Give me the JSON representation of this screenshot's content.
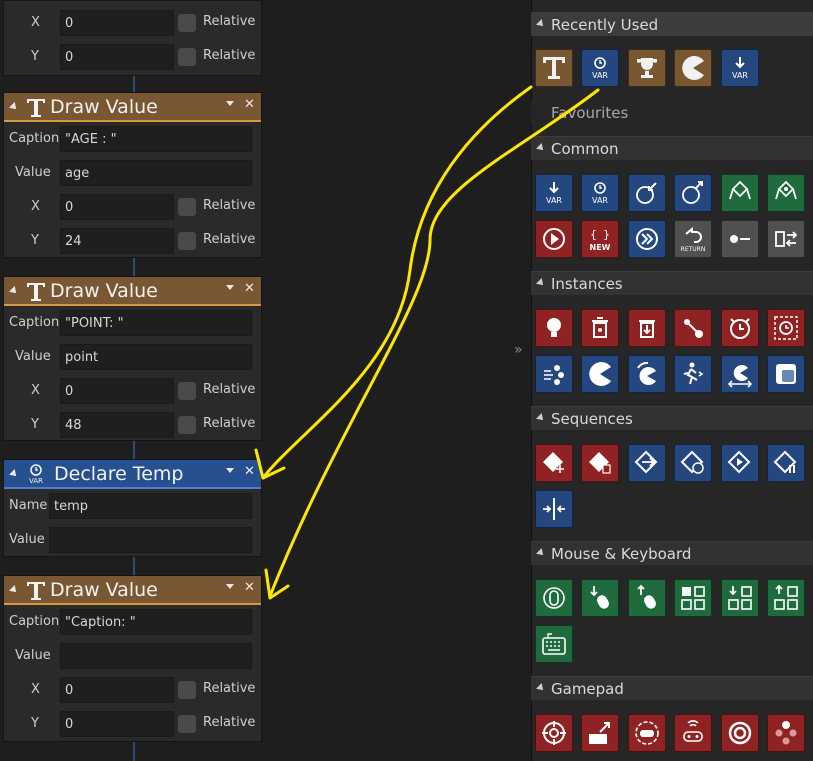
{
  "blocks": {
    "top_partial": {
      "x_label": "X",
      "x_value": "0",
      "x_rel": "Relative",
      "y_label": "Y",
      "y_value": "0",
      "y_rel": "Relative"
    },
    "draw_value_1": {
      "title": "Draw Value",
      "caption_label": "Caption",
      "caption_value": "\"AGE : \"",
      "value_label": "Value",
      "value_value": "age",
      "x_label": "X",
      "x_value": "0",
      "x_rel": "Relative",
      "y_label": "Y",
      "y_value": "24",
      "y_rel": "Relative"
    },
    "draw_value_2": {
      "title": "Draw Value",
      "caption_label": "Caption",
      "caption_value": "\"POINT: \"",
      "value_label": "Value",
      "value_value": "point",
      "x_label": "X",
      "x_value": "0",
      "x_rel": "Relative",
      "y_label": "Y",
      "y_value": "48",
      "y_rel": "Relative"
    },
    "declare_temp": {
      "title": "Declare Temp",
      "icon_text": "VAR",
      "name_label": "Name",
      "name_value": "temp",
      "value_label": "Value",
      "value_value": ""
    },
    "draw_value_3": {
      "title": "Draw Value",
      "caption_label": "Caption",
      "caption_value": "\"Caption: \"",
      "value_label": "Value",
      "value_value": "",
      "x_label": "X",
      "x_value": "0",
      "x_rel": "Relative",
      "y_label": "Y",
      "y_value": "0",
      "y_rel": "Relative"
    }
  },
  "panel": {
    "expand_glyph": "»",
    "sections": {
      "recently_used": "Recently Used",
      "favourites": "Favourites",
      "common": "Common",
      "instances": "Instances",
      "sequences": "Sequences",
      "mouse_keyboard": "Mouse & Keyboard",
      "gamepad": "Gamepad"
    },
    "tile_texts": {
      "var": "VAR",
      "new": "NEW",
      "return": "RETURN"
    }
  },
  "colors": {
    "brown_header": "#7a5733",
    "blue_header": "#26508f",
    "annotation": "#ffe600"
  }
}
